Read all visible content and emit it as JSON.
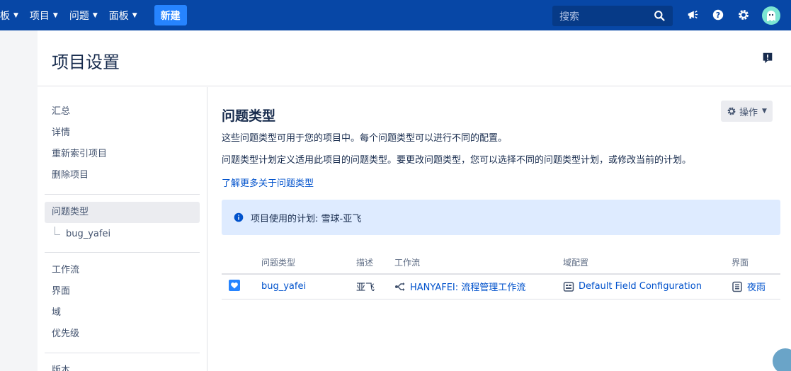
{
  "topnav": {
    "items": [
      {
        "label": "板"
      },
      {
        "label": "项目"
      },
      {
        "label": "问题"
      },
      {
        "label": "面板"
      }
    ],
    "create_label": "新建",
    "search_placeholder": "搜索",
    "colors": {
      "bar": "#0747a6",
      "create": "#2684ff"
    }
  },
  "header": {
    "title": "项目设置"
  },
  "sidebar": {
    "group1": [
      "汇总",
      "详情",
      "重新索引项目",
      "删除项目"
    ],
    "active_item": "问题类型",
    "sub_item": "bug_yafei",
    "group2": [
      "工作流",
      "界面",
      "域",
      "优先级"
    ],
    "group3": [
      "版本"
    ]
  },
  "content": {
    "title": "问题类型",
    "actions_label": "操作",
    "desc1": "这些问题类型可用于您的项目中。每个问题类型可以进行不同的配置。",
    "desc2": "问题类型计划定义适用此项目的问题类型。要更改问题类型，您可以选择不同的问题类型计划，或修改当前的计划。",
    "learn_more": "了解更多关于问题类型",
    "scheme_info": "项目使用的计划: 雪球-亚飞"
  },
  "table": {
    "headers": {
      "type": "问题类型",
      "desc": "描述",
      "workflow": "工作流",
      "field_config": "域配置",
      "screen": "界面"
    },
    "rows": [
      {
        "type": "bug_yafei",
        "desc": "亚飞",
        "workflow": "HANYAFEI: 流程管理工作流",
        "field_config": "Default Field Configuration",
        "screen": "夜雨"
      }
    ]
  }
}
